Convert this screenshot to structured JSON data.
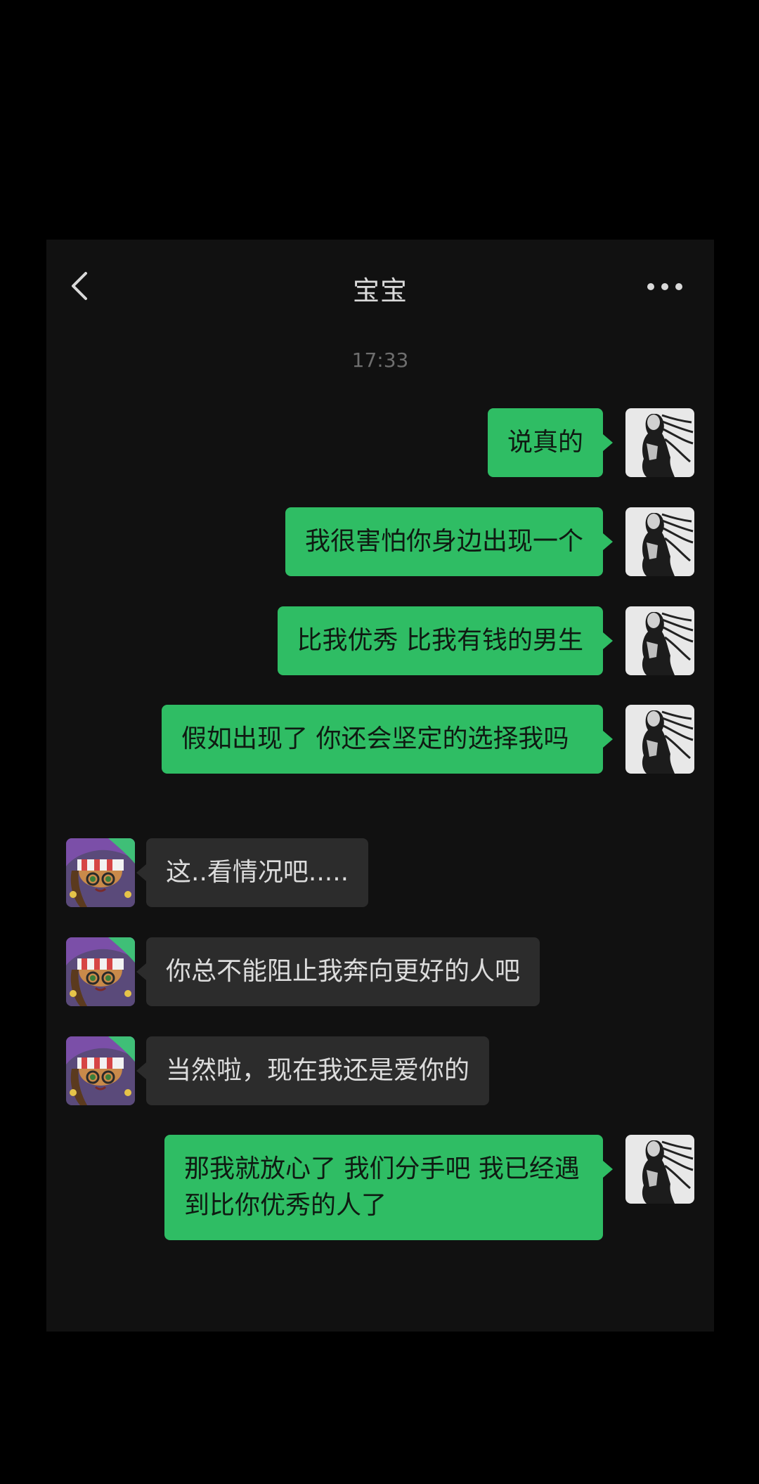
{
  "header": {
    "title": "宝宝",
    "back_icon": "chevron-left-icon",
    "more_icon": "more-dots-icon"
  },
  "timestamp": "17:33",
  "colors": {
    "outgoing_bubble": "#2fbd64",
    "incoming_bubble": "#2c2c2c",
    "background": "#111111"
  },
  "messages": [
    {
      "direction": "out",
      "text": "说真的"
    },
    {
      "direction": "out",
      "text": "我很害怕你身边出现一个"
    },
    {
      "direction": "out",
      "text": "比我优秀 比我有钱的男生"
    },
    {
      "direction": "out",
      "text": "假如出现了 你还会坚定的选择我吗"
    },
    {
      "direction": "in",
      "text": "这..看情况吧....."
    },
    {
      "direction": "in",
      "text": "你总不能阻止我奔向更好的人吧"
    },
    {
      "direction": "in",
      "text": "当然啦，现在我还是爱你的"
    },
    {
      "direction": "out",
      "text": "那我就放心了 我们分手吧 我已经遇到比你优秀的人了"
    }
  ]
}
